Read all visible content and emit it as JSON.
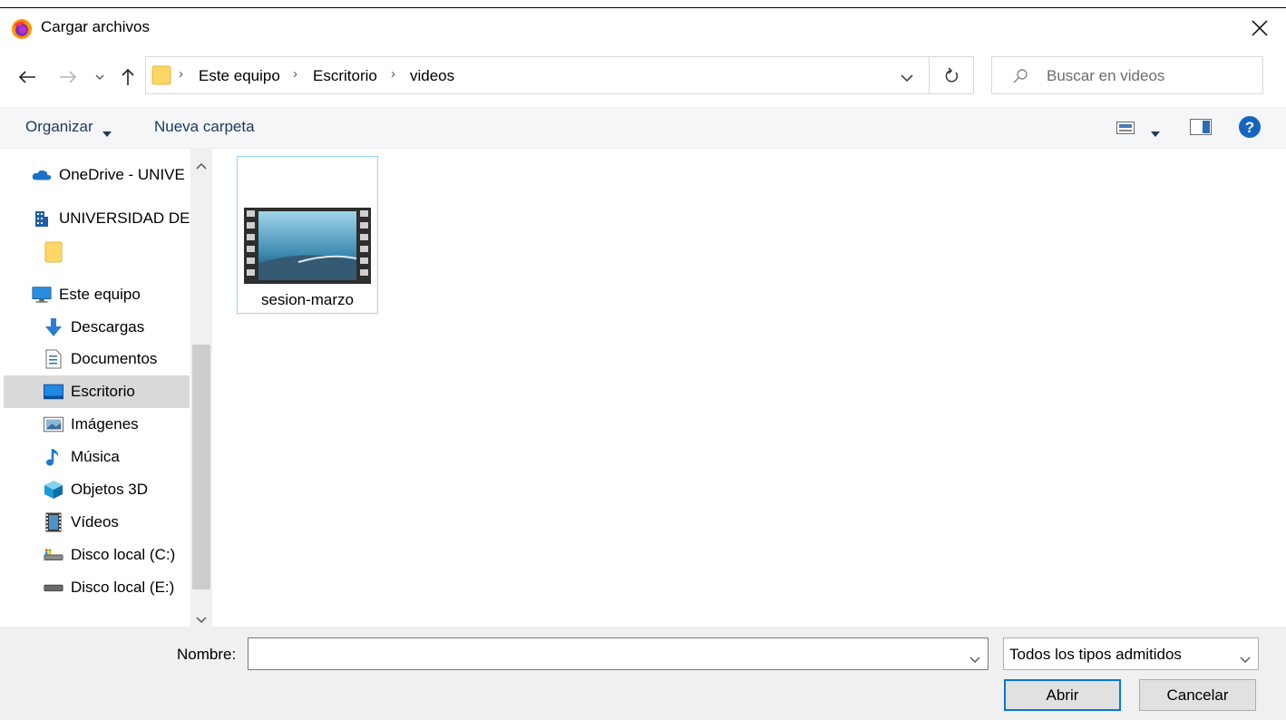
{
  "window": {
    "title": "Cargar archivos"
  },
  "address": {
    "crumbs": [
      "Este equipo",
      "Escritorio",
      "videos"
    ]
  },
  "search": {
    "placeholder": "Buscar en videos"
  },
  "toolbar": {
    "organize_label": "Organizar",
    "new_folder_label": "Nueva carpeta"
  },
  "sidebar": {
    "items": [
      {
        "label": "OneDrive - UNIVE",
        "icon": "cloud-icon"
      },
      {
        "label": "UNIVERSIDAD DE",
        "icon": "building-icon"
      },
      {
        "label": "",
        "icon": "folder-icon"
      },
      {
        "label": "Este equipo",
        "icon": "computer-icon"
      },
      {
        "label": "Descargas",
        "icon": "download-icon"
      },
      {
        "label": "Documentos",
        "icon": "document-icon"
      },
      {
        "label": "Escritorio",
        "icon": "desktop-icon",
        "selected": true
      },
      {
        "label": "Imágenes",
        "icon": "pictures-icon"
      },
      {
        "label": "Música",
        "icon": "music-icon"
      },
      {
        "label": "Objetos 3D",
        "icon": "cube-icon"
      },
      {
        "label": "Vídeos",
        "icon": "film-icon"
      },
      {
        "label": "Disco local (C:)",
        "icon": "drive-c-icon"
      },
      {
        "label": "Disco local (E:)",
        "icon": "drive-e-icon"
      }
    ]
  },
  "files": [
    {
      "name": "sesion-marzo",
      "type": "video"
    }
  ],
  "footer": {
    "name_label": "Nombre:",
    "name_value": "",
    "filetype_selected": "Todos los tipos admitidos",
    "open_label": "Abrir",
    "cancel_label": "Cancelar"
  },
  "colors": {
    "accent": "#0078d7",
    "selection": "#d9d9d9",
    "toolbar_text": "#1e395b"
  }
}
